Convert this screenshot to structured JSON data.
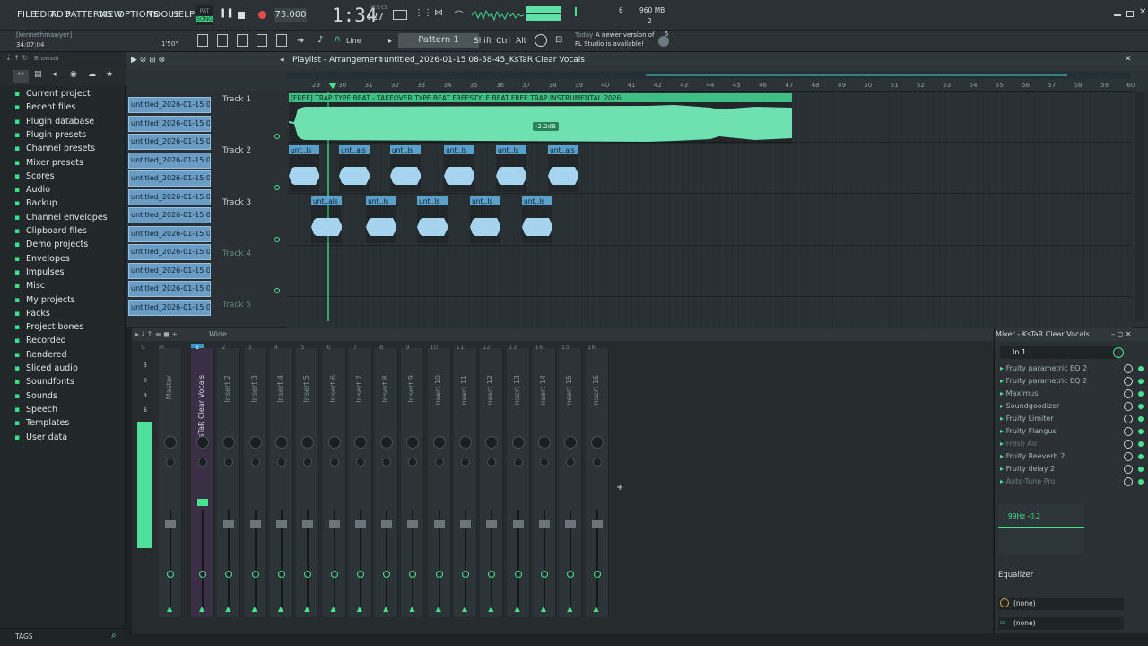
{
  "menu": {
    "items": [
      "FILE",
      "EDIT",
      "ADD",
      "PATTERNS",
      "VIEW",
      "OPTIONS",
      "TOOLS",
      "HELP"
    ]
  },
  "transport": {
    "pat_label": "PAT",
    "song_label": "SONG",
    "tempo": "73.000",
    "time": "1:34",
    "time_sub": ":27",
    "time_unit": "M:S:CS",
    "cpu_num": "6",
    "memory": "960 MB",
    "voices": "2"
  },
  "user": {
    "name": "[kennethmawyer]",
    "time": "34:07:04"
  },
  "toolbar": {
    "snap": "1'50\"",
    "line_label": "Line",
    "pattern_label": "Pattern 1",
    "shift": "Shift",
    "ctrl": "Ctrl",
    "alt": "Alt"
  },
  "news": {
    "title": "Today",
    "text1": "A newer version of",
    "text2": "FL Studio is available!",
    "count": "5"
  },
  "browser": {
    "title": "Browser",
    "items": [
      "Current project",
      "Recent files",
      "Plugin database",
      "Plugin presets",
      "Channel presets",
      "Mixer presets",
      "Scores",
      "Audio",
      "Backup",
      "Channel envelopes",
      "Clipboard files",
      "Demo projects",
      "Envelopes",
      "Impulses",
      "Misc",
      "My projects",
      "Packs",
      "Project bones",
      "Recorded",
      "Rendered",
      "Sliced audio",
      "Soundfonts",
      "Sounds",
      "Speech",
      "Templates",
      "User data"
    ],
    "tags": "TAGS"
  },
  "playlist": {
    "title": "Playlist - Arrangement",
    "file": "untitled_2026-01-15 08-58-45_KsTaR Clear Vocals",
    "clips_list": [
      "untitled_2026-01-15 08-...",
      "untitled_2026-01-15 08-...",
      "untitled_2026-01-15 08-...",
      "untitled_2026-01-15 08-...",
      "untitled_2026-01-15 08-...",
      "untitled_2026-01-15 08-...",
      "untitled_2026-01-15 08-...",
      "untitled_2026-01-15 08-...",
      "untitled_2026-01-15 08-...",
      "untitled_2026-01-15 08-...",
      "untitled_2026-01-15 08-...",
      "untitled_2026-01-15 08-..."
    ],
    "tracks": [
      "Track 1",
      "Track 2",
      "Track 3",
      "Track 4",
      "Track 5"
    ],
    "main_clip": "[FREE] TRAP TYPE BEAT - TAKEOVER  TYPE BEAT  FREESTYLE BEAT  FREE TRAP INSTRUMENTAL 2026",
    "gain": "-2.2dB",
    "small_clips_t2": [
      "unt..ls",
      "unt..als",
      "unt..ls",
      "unt..ls",
      "unt..ls",
      "unt..als"
    ],
    "small_clips_t3": [
      "unt..als",
      "unt..ls",
      "unt..ls",
      "unt..ls",
      "unt..ls"
    ],
    "ruler": [
      "29",
      "30",
      "31",
      "32",
      "33",
      "34",
      "35",
      "36",
      "37",
      "38",
      "39",
      "40",
      "41",
      "42",
      "43",
      "44",
      "45",
      "46",
      "47",
      "48",
      "49",
      "50",
      "51",
      "52",
      "53",
      "54",
      "55",
      "56",
      "57",
      "58",
      "59",
      "60"
    ]
  },
  "mixer": {
    "mode": "Wide",
    "strips": [
      "Master",
      "KsTaR Clear Vocals",
      "Insert 2",
      "Insert 3",
      "Insert 4",
      "Insert 5",
      "Insert 6",
      "Insert 7",
      "Insert 8",
      "Insert 9",
      "Insert 10",
      "Insert 11",
      "Insert 12",
      "Insert 13",
      "Insert 14",
      "Insert 15",
      "Insert 16"
    ],
    "numbers": [
      "C",
      "M",
      "1",
      "2",
      "3",
      "4",
      "5",
      "6",
      "7",
      "8",
      "9",
      "10",
      "11",
      "12",
      "13",
      "14",
      "15",
      "16"
    ],
    "meter_vals": [
      "3",
      "0",
      "3",
      "6"
    ]
  },
  "fx": {
    "title": "Mixer - KsTaR Clear Vocals",
    "input": "In 1",
    "slots": [
      "Fruity parametric EQ 2",
      "Fruity parametric EQ 2",
      "Maximus",
      "Soundgoodizer",
      "Fruity Limiter",
      "Fruity Flangus",
      "Fresh Air",
      "Fruity Reeverb 2",
      "Fruity delay 2",
      "Auto-Tune Pro"
    ],
    "eq_readout": "99Hz -0.2",
    "eq_label": "Equalizer",
    "out1": "(none)",
    "out2": "(none)"
  }
}
